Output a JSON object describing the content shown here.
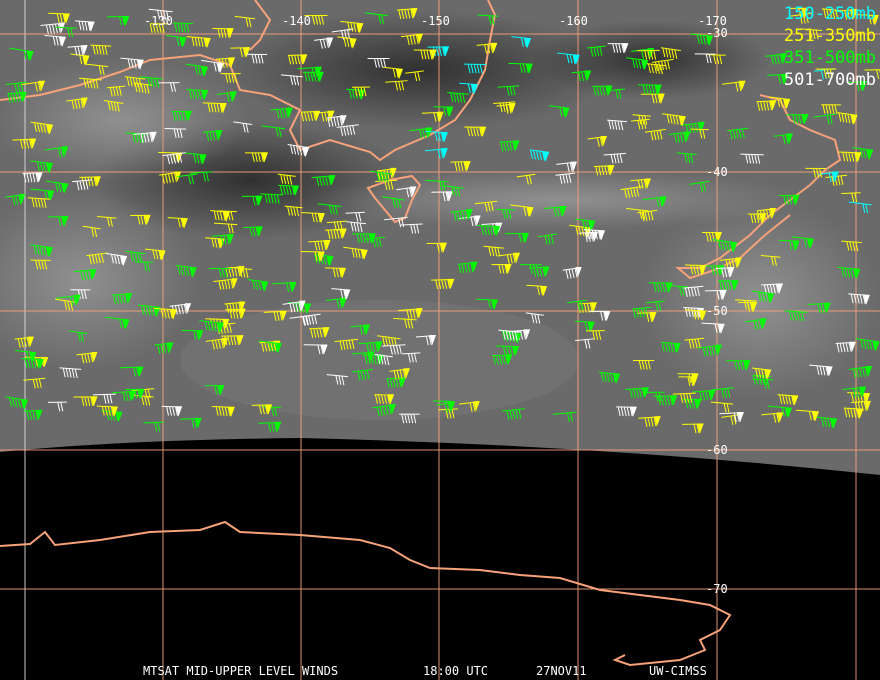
{
  "legend": [
    {
      "label": "150-250mb",
      "color": "#00ffff"
    },
    {
      "label": "251-350mb",
      "color": "#ffff00"
    },
    {
      "label": "351-500mb",
      "color": "#00ff00"
    },
    {
      "label": "501-700mb",
      "color": "#ffffff"
    }
  ],
  "longitude_labels": [
    "-130",
    "-140",
    "-150",
    "-160",
    "-170"
  ],
  "latitude_labels": [
    "-30",
    "-40",
    "-50",
    "-60",
    "-70"
  ],
  "caption": {
    "product": "MTSAT MID-UPPER LEVEL WINDS",
    "time": "18:00 UTC",
    "date": "27NOV11",
    "source": "UW-CIMSS"
  },
  "colors": {
    "coastline": "#f7a27a",
    "grid": "#f7a27a",
    "grid_light": "#d8d8d8"
  }
}
